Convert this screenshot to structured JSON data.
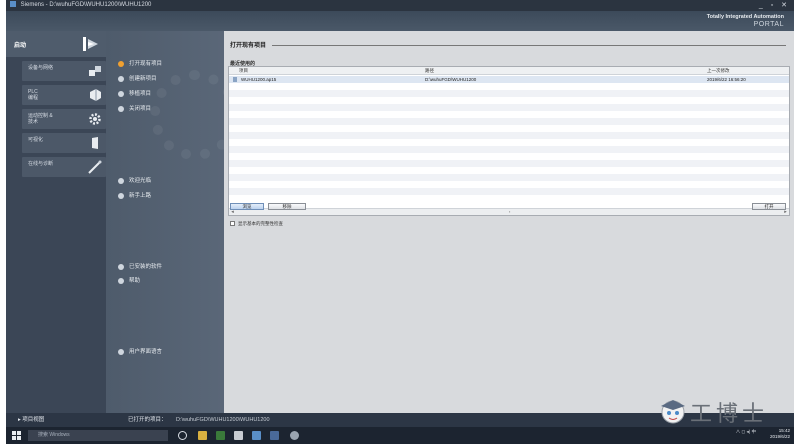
{
  "window": {
    "title": "Siemens - D:\\wuhuFGD\\WUHU1200\\WUHU1200",
    "controls": "_ ▫ ✕"
  },
  "header": {
    "brand_line1": "Totally Integrated Automation",
    "brand_line2": "PORTAL"
  },
  "sidebar": {
    "start_label": "启动",
    "items": [
      {
        "label": "设备与网络",
        "icon": "devices-network-icon"
      },
      {
        "label": "PLC\n编程",
        "icon": "plc-programming-icon"
      },
      {
        "label": "运动控制 &\n技术",
        "icon": "motion-control-gear-icon"
      },
      {
        "label": "可视化",
        "icon": "visualization-icon"
      },
      {
        "label": "在线与诊断",
        "icon": "online-diagnostics-icon"
      }
    ]
  },
  "actions": {
    "open_project": "打开现有项目",
    "create_project": "创建新项目",
    "migrate_project": "移植项目",
    "close_project": "关闭项目",
    "welcome_tour": "欢迎光临",
    "first_steps": "新手上路",
    "installed_software": "已安装的软件",
    "help": "帮助",
    "ui_language": "用户界面语言"
  },
  "content": {
    "title": "打开现有项目",
    "recent_label": "最近使用的",
    "table": {
      "columns": [
        "项目",
        "路径",
        "上一次修改"
      ],
      "rows": [
        {
          "project": "WUHU1200.ap15",
          "path": "D:\\wuhuFGD\\WUHU1200",
          "modified": "2019/6/22 16:56:20"
        }
      ]
    },
    "checkbox_label": "显示基本的完整性检查",
    "browse_button": "浏览",
    "remove_button": "移除",
    "open_button": "打开"
  },
  "statusbar": {
    "project_view": "项目视图",
    "opened_project_label": "已打开的项目：",
    "opened_project_path": "D:\\wuhuFGD\\WUHU1200\\WUHU1200"
  },
  "taskbar": {
    "search_placeholder": "搜索 Windows",
    "clock_time": "15:42",
    "clock_date": "2019/6/22"
  },
  "watermark": {
    "text": "工博士"
  },
  "colors": {
    "active_dot": "#f0a030",
    "sidebar_bg": "#3b4656",
    "content_bg": "#d8dadd",
    "selected_row": "#dde6f2"
  }
}
